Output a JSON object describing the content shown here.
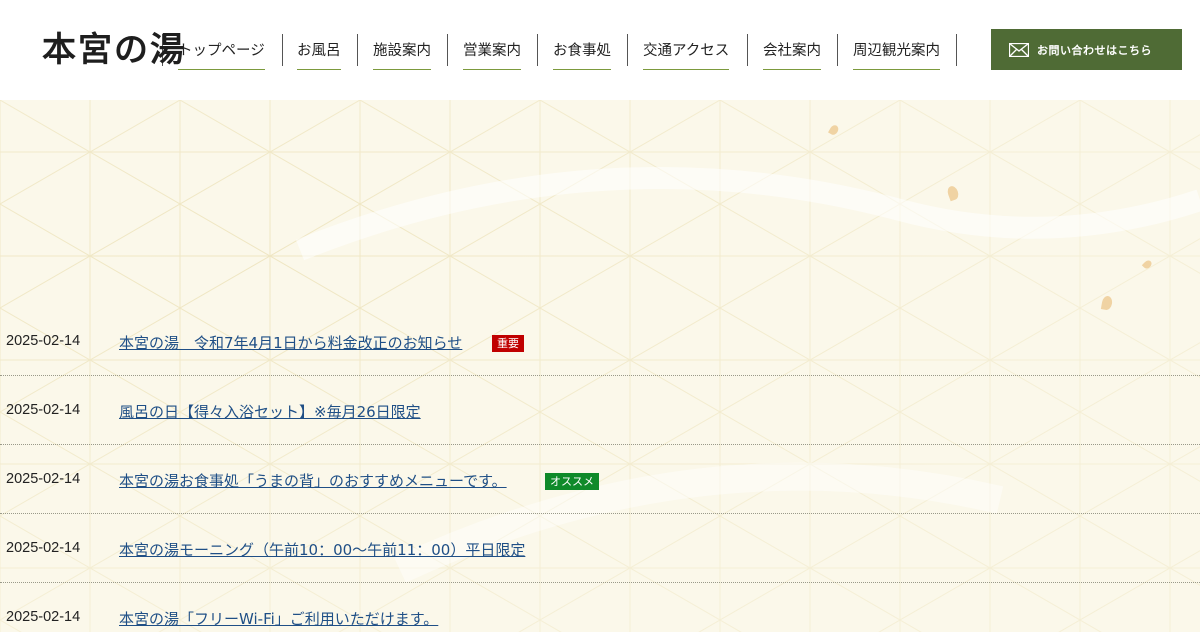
{
  "header": {
    "logo_text": "本宮の湯",
    "nav": [
      {
        "label": "トップページ"
      },
      {
        "label": "お風呂"
      },
      {
        "label": "施設案内"
      },
      {
        "label": "営業案内"
      },
      {
        "label": "お食事処"
      },
      {
        "label": "交通アクセス"
      },
      {
        "label": "会社案内"
      },
      {
        "label": "周辺観光案内"
      }
    ],
    "contact_label": "お問い合わせはこちら",
    "contact_icon": "mail-icon"
  },
  "colors": {
    "accent_green": "#4f6b35",
    "nav_underline": "#7c9a3d",
    "link": "#1f4f86",
    "badge_important": "#c00000",
    "badge_recommend": "#0f8a2a",
    "background": "#fbf8ea"
  },
  "news": [
    {
      "date": "2025-02-14",
      "title": "本宮の湯　令和7年4月1日から料金改正のお知らせ",
      "badge": "重要",
      "badge_type": "important"
    },
    {
      "date": "2025-02-14",
      "title": "風呂の日【得々入浴セット】※毎月26日限定",
      "badge": "",
      "badge_type": ""
    },
    {
      "date": "2025-02-14",
      "title": "本宮の湯お食事処「うまの背」のおすすめメニューです。",
      "badge": "オススメ",
      "badge_type": "recommend"
    },
    {
      "date": "2025-02-14",
      "title": "本宮の湯モーニング（午前10：00〜午前11：00）平日限定",
      "badge": "",
      "badge_type": ""
    },
    {
      "date": "2025-02-14",
      "title": "本宮の湯「フリーWi-Fi」ご利用いただけます。",
      "badge": "",
      "badge_type": ""
    }
  ]
}
